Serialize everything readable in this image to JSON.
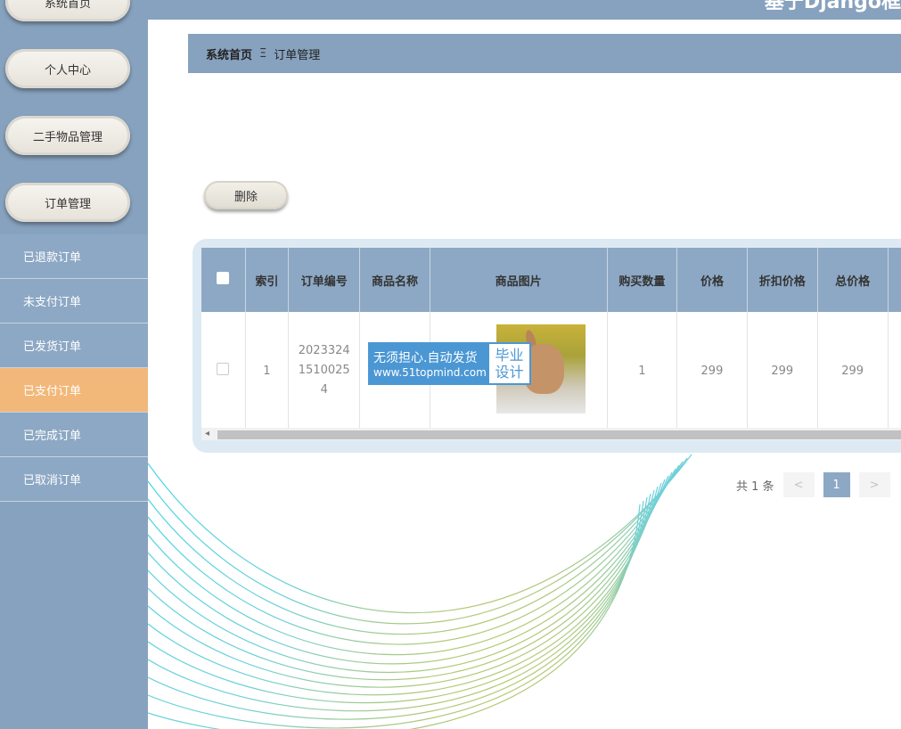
{
  "sidebar": {
    "top_buttons": [
      "系统首页",
      "个人中心",
      "二手物品管理",
      "订单管理"
    ],
    "sub_items": [
      "已退款订单",
      "未支付订单",
      "已发货订单",
      "已支付订单",
      "已完成订单",
      "已取消订单"
    ],
    "active_sub": "已支付订单"
  },
  "topbar": {
    "title": "基于Django框"
  },
  "breadcrumb": {
    "home": "系统首页",
    "separator": "Ξ",
    "current": "订单管理"
  },
  "toolbar": {
    "delete_label": "删除"
  },
  "table": {
    "headers": [
      "索引",
      "订单编号",
      "商品名称",
      "商品图片",
      "购买数量",
      "价格",
      "折扣价格",
      "总价格"
    ],
    "row": {
      "index": "1",
      "order_no_lines": [
        "2023324",
        "1510025",
        "4"
      ],
      "goods_name": "",
      "quantity": "1",
      "price": "299",
      "discount_price": "299",
      "total_price": "299"
    }
  },
  "watermark": {
    "line1": "无须担心.自动发货",
    "line2": "www.51topmind.com",
    "box1": "毕业",
    "box2": "设计"
  },
  "pagination": {
    "total_text": "共 1 条",
    "prev": "<",
    "current_page": "1",
    "next": ">"
  },
  "colors": {
    "sidebar": "#87a2be",
    "active": "#f2b87a",
    "header": "#8da8c4"
  }
}
